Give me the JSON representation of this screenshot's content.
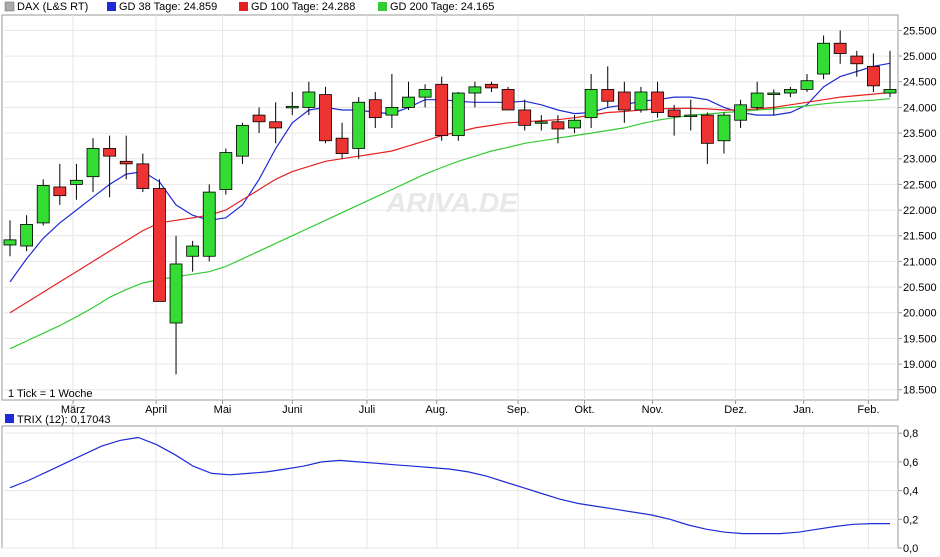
{
  "chart_data": [
    {
      "type": "candlestick",
      "legend_position": "top-left",
      "legend": [
        {
          "label": "DAX (L&S RT)",
          "color": "#888888"
        },
        {
          "label": "GD 38 Tage: 24.859",
          "color": "#1f2bd6"
        },
        {
          "label": "GD 100 Tage: 24.288",
          "color": "#e62020"
        },
        {
          "label": "GD 200 Tage: 24.165",
          "color": "#33cc33"
        }
      ],
      "watermark": "ARIVA.DE",
      "tick_note": "1 Tick = 1 Woche",
      "y_axis": {
        "ticks": [
          "18.500",
          "19.000",
          "19.500",
          "20.000",
          "20.500",
          "21.000",
          "21.500",
          "22.000",
          "22.500",
          "23.000",
          "23.500",
          "24.000",
          "24.500",
          "25.000",
          "25.500"
        ],
        "range": [
          18300,
          25800
        ],
        "position": "right"
      },
      "x_axis": {
        "ticks": [
          {
            "label": "März",
            "index": 3.8
          },
          {
            "label": "April",
            "index": 8.8
          },
          {
            "label": "Mai",
            "index": 12.8
          },
          {
            "label": "Juni",
            "index": 17
          },
          {
            "label": "Juli",
            "index": 21.5
          },
          {
            "label": "Aug.",
            "index": 25.7
          },
          {
            "label": "Sep.",
            "index": 30.6
          },
          {
            "label": "Okt.",
            "index": 34.6
          },
          {
            "label": "Nov.",
            "index": 38.7
          },
          {
            "label": "Dez.",
            "index": 43.7
          },
          {
            "label": "Jan.",
            "index": 47.8
          },
          {
            "label": "Feb.",
            "index": 51.7
          }
        ]
      },
      "grid": true,
      "up_color": "#33dd33",
      "down_color": "#ee3333",
      "candles": [
        {
          "o": 21.32,
          "h": 21.8,
          "l": 21.1,
          "c": 21.42
        },
        {
          "o": 21.3,
          "h": 21.9,
          "l": 21.2,
          "c": 21.72
        },
        {
          "o": 21.75,
          "h": 22.6,
          "l": 21.7,
          "c": 22.48
        },
        {
          "o": 22.45,
          "h": 22.9,
          "l": 22.1,
          "c": 22.28
        },
        {
          "o": 22.5,
          "h": 22.9,
          "l": 22.2,
          "c": 22.58
        },
        {
          "o": 22.65,
          "h": 23.4,
          "l": 22.35,
          "c": 23.2
        },
        {
          "o": 23.2,
          "h": 23.45,
          "l": 22.25,
          "c": 23.05
        },
        {
          "o": 22.95,
          "h": 23.45,
          "l": 22.6,
          "c": 22.9
        },
        {
          "o": 22.9,
          "h": 23.1,
          "l": 22.35,
          "c": 22.42
        },
        {
          "o": 22.42,
          "h": 22.6,
          "l": 22.05,
          "c": 20.22
        },
        {
          "o": 19.8,
          "h": 21.5,
          "l": 18.8,
          "c": 20.95
        },
        {
          "o": 21.1,
          "h": 21.4,
          "l": 20.8,
          "c": 21.3
        },
        {
          "o": 21.1,
          "h": 22.5,
          "l": 21.0,
          "c": 22.35
        },
        {
          "o": 22.4,
          "h": 23.2,
          "l": 22.3,
          "c": 23.12
        },
        {
          "o": 23.05,
          "h": 23.7,
          "l": 22.9,
          "c": 23.65
        },
        {
          "o": 23.85,
          "h": 24.0,
          "l": 23.5,
          "c": 23.72
        },
        {
          "o": 23.72,
          "h": 24.1,
          "l": 23.3,
          "c": 23.6
        },
        {
          "o": 24.0,
          "h": 24.3,
          "l": 23.85,
          "c": 24.02
        },
        {
          "o": 24.0,
          "h": 24.5,
          "l": 23.85,
          "c": 24.3
        },
        {
          "o": 24.25,
          "h": 24.4,
          "l": 23.3,
          "c": 23.35
        },
        {
          "o": 23.4,
          "h": 23.7,
          "l": 23.0,
          "c": 23.1
        },
        {
          "o": 23.2,
          "h": 24.2,
          "l": 23.0,
          "c": 24.1
        },
        {
          "o": 24.15,
          "h": 24.3,
          "l": 23.6,
          "c": 23.8
        },
        {
          "o": 23.85,
          "h": 24.65,
          "l": 23.6,
          "c": 24.0
        },
        {
          "o": 24.0,
          "h": 24.5,
          "l": 23.95,
          "c": 24.2
        },
        {
          "o": 24.2,
          "h": 24.45,
          "l": 24.0,
          "c": 24.35
        },
        {
          "o": 24.45,
          "h": 24.6,
          "l": 23.35,
          "c": 23.45
        },
        {
          "o": 23.45,
          "h": 24.3,
          "l": 23.35,
          "c": 24.28
        },
        {
          "o": 24.28,
          "h": 24.5,
          "l": 24.0,
          "c": 24.4
        },
        {
          "o": 24.45,
          "h": 24.5,
          "l": 24.3,
          "c": 24.38
        },
        {
          "o": 24.35,
          "h": 24.4,
          "l": 23.95,
          "c": 23.95
        },
        {
          "o": 23.95,
          "h": 24.15,
          "l": 23.55,
          "c": 23.65
        },
        {
          "o": 23.7,
          "h": 23.85,
          "l": 23.55,
          "c": 23.72
        },
        {
          "o": 23.72,
          "h": 23.85,
          "l": 23.3,
          "c": 23.58
        },
        {
          "o": 23.6,
          "h": 23.85,
          "l": 23.5,
          "c": 23.75
        },
        {
          "o": 23.8,
          "h": 24.65,
          "l": 23.6,
          "c": 24.35
        },
        {
          "o": 24.35,
          "h": 24.8,
          "l": 24.0,
          "c": 24.12
        },
        {
          "o": 24.3,
          "h": 24.5,
          "l": 23.7,
          "c": 23.95
        },
        {
          "o": 23.95,
          "h": 24.4,
          "l": 23.9,
          "c": 24.3
        },
        {
          "o": 24.3,
          "h": 24.5,
          "l": 23.8,
          "c": 23.9
        },
        {
          "o": 23.95,
          "h": 24.05,
          "l": 23.45,
          "c": 23.82
        },
        {
          "o": 23.85,
          "h": 24.15,
          "l": 23.55,
          "c": 23.85
        },
        {
          "o": 23.85,
          "h": 23.9,
          "l": 22.9,
          "c": 23.3
        },
        {
          "o": 23.35,
          "h": 23.9,
          "l": 23.1,
          "c": 23.85
        },
        {
          "o": 23.75,
          "h": 24.15,
          "l": 23.6,
          "c": 24.05
        },
        {
          "o": 24.0,
          "h": 24.5,
          "l": 23.95,
          "c": 24.28
        },
        {
          "o": 24.28,
          "h": 24.35,
          "l": 23.85,
          "c": 24.28
        },
        {
          "o": 24.28,
          "h": 24.4,
          "l": 24.2,
          "c": 24.35
        },
        {
          "o": 24.35,
          "h": 24.65,
          "l": 24.3,
          "c": 24.52
        },
        {
          "o": 24.65,
          "h": 25.4,
          "l": 24.55,
          "c": 25.25
        },
        {
          "o": 25.25,
          "h": 25.5,
          "l": 24.85,
          "c": 25.05
        },
        {
          "o": 25.0,
          "h": 25.1,
          "l": 24.6,
          "c": 24.85
        },
        {
          "o": 24.8,
          "h": 25.05,
          "l": 24.3,
          "c": 24.42
        },
        {
          "o": 24.28,
          "h": 25.1,
          "l": 24.2,
          "c": 24.35
        }
      ],
      "series": [
        {
          "name": "GD 38 Tage",
          "color": "#1f2bd6",
          "values": [
            20.6,
            21.05,
            21.45,
            21.75,
            22.0,
            22.25,
            22.5,
            22.7,
            22.75,
            22.55,
            22.1,
            21.9,
            21.8,
            21.85,
            22.1,
            22.6,
            23.2,
            23.7,
            23.95,
            24.0,
            23.95,
            23.95,
            23.9,
            23.88,
            24.0,
            24.15,
            24.15,
            24.12,
            24.1,
            24.1,
            24.1,
            24.12,
            24.05,
            23.95,
            23.88,
            23.9,
            24.0,
            24.05,
            24.12,
            24.15,
            24.2,
            24.2,
            24.15,
            24.0,
            23.9,
            23.85,
            23.85,
            23.9,
            24.05,
            24.4,
            24.6,
            24.7,
            24.8,
            24.86
          ]
        },
        {
          "name": "GD 100 Tage",
          "color": "#e62020",
          "values": [
            20.0,
            20.2,
            20.4,
            20.6,
            20.8,
            21.0,
            21.2,
            21.4,
            21.6,
            21.75,
            21.8,
            21.85,
            21.9,
            22.0,
            22.2,
            22.4,
            22.6,
            22.75,
            22.85,
            22.95,
            23.0,
            23.05,
            23.1,
            23.15,
            23.25,
            23.35,
            23.45,
            23.52,
            23.6,
            23.65,
            23.7,
            23.72,
            23.74,
            23.76,
            23.8,
            23.85,
            23.9,
            23.92,
            23.95,
            23.97,
            23.98,
            23.98,
            23.97,
            23.95,
            23.95,
            23.97,
            24.0,
            24.05,
            24.1,
            24.15,
            24.2,
            24.23,
            24.26,
            24.29
          ]
        },
        {
          "name": "GD 200 Tage",
          "color": "#33cc33",
          "values": [
            19.3,
            19.45,
            19.6,
            19.75,
            19.92,
            20.1,
            20.3,
            20.45,
            20.58,
            20.65,
            20.7,
            20.75,
            20.8,
            20.9,
            21.05,
            21.2,
            21.35,
            21.5,
            21.65,
            21.8,
            21.95,
            22.1,
            22.25,
            22.4,
            22.55,
            22.7,
            22.83,
            22.95,
            23.05,
            23.15,
            23.22,
            23.3,
            23.35,
            23.4,
            23.45,
            23.5,
            23.55,
            23.6,
            23.68,
            23.75,
            23.8,
            23.85,
            23.87,
            23.9,
            23.92,
            23.95,
            23.97,
            24.0,
            24.03,
            24.07,
            24.1,
            24.12,
            24.14,
            24.17
          ]
        }
      ]
    },
    {
      "type": "line",
      "legend": [
        {
          "label": "TRIX (12): 0,17043",
          "color": "#1f2bd6"
        }
      ],
      "legend_position": "top-left",
      "y_axis": {
        "ticks": [
          "0,0",
          "0,2",
          "0,4",
          "0,6",
          "0,8"
        ],
        "range": [
          0,
          0.85
        ],
        "position": "right"
      },
      "grid": true,
      "series": [
        {
          "name": "TRIX (12)",
          "color": "#1f2bd6",
          "values": [
            0.42,
            0.47,
            0.53,
            0.59,
            0.65,
            0.71,
            0.75,
            0.77,
            0.72,
            0.65,
            0.57,
            0.52,
            0.51,
            0.52,
            0.53,
            0.55,
            0.57,
            0.6,
            0.61,
            0.6,
            0.59,
            0.58,
            0.57,
            0.56,
            0.55,
            0.53,
            0.5,
            0.46,
            0.42,
            0.38,
            0.34,
            0.31,
            0.29,
            0.27,
            0.25,
            0.23,
            0.2,
            0.16,
            0.13,
            0.11,
            0.1,
            0.1,
            0.1,
            0.11,
            0.13,
            0.15,
            0.165,
            0.17,
            0.17
          ]
        }
      ]
    }
  ]
}
